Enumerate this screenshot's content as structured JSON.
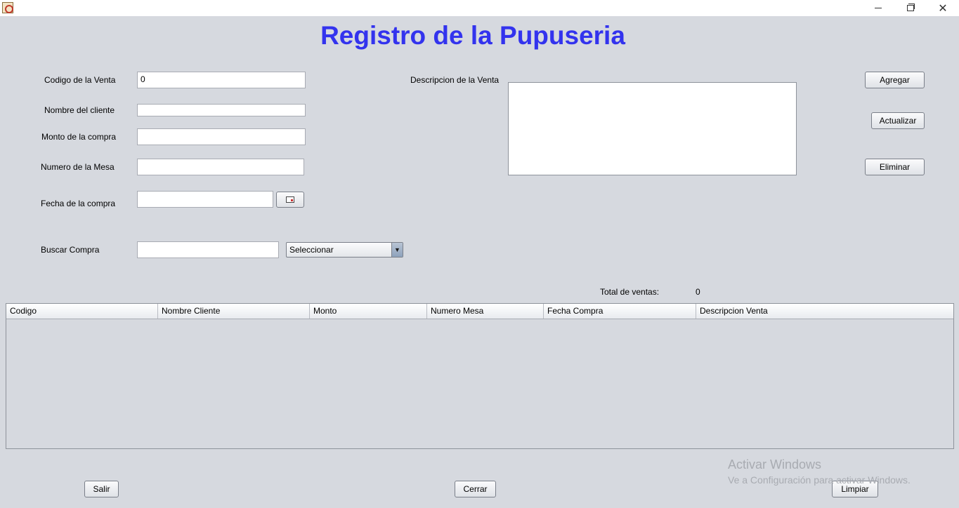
{
  "window": {
    "app_icon": "java-coffee-icon",
    "controls": {
      "minimize": "–",
      "maximize": "❐",
      "close": "✕"
    }
  },
  "title": "Registro de la Pupuseria",
  "form": {
    "codigo_label": "Codigo de la Venta",
    "codigo_value": "0",
    "nombre_label": "Nombre del cliente",
    "nombre_value": "",
    "monto_label": "Monto de la compra",
    "monto_value": "",
    "mesa_label": "Numero de la Mesa",
    "mesa_value": "",
    "fecha_label": "Fecha de la compra",
    "fecha_value": "",
    "buscar_label": "Buscar Compra",
    "buscar_value": "",
    "buscar_select": "Seleccionar",
    "descripcion_label": "Descripcion de la Venta",
    "descripcion_value": ""
  },
  "actions": {
    "agregar": "Agregar",
    "actualizar": "Actualizar",
    "eliminar": "Eliminar",
    "salir": "Salir",
    "cerrar": "Cerrar",
    "limpiar": "Limpiar"
  },
  "totals": {
    "label": "Total de ventas:",
    "value": "0"
  },
  "table": {
    "columns": [
      "Codigo",
      "Nombre Cliente",
      "Monto",
      "Numero Mesa",
      "Fecha Compra",
      "Descripcion Venta"
    ],
    "rows": []
  },
  "watermark": {
    "line1": "Activar Windows",
    "line2": "Ve a Configuración para activar Windows."
  },
  "colors": {
    "title": "#3333ee",
    "background": "#d6d9df"
  }
}
